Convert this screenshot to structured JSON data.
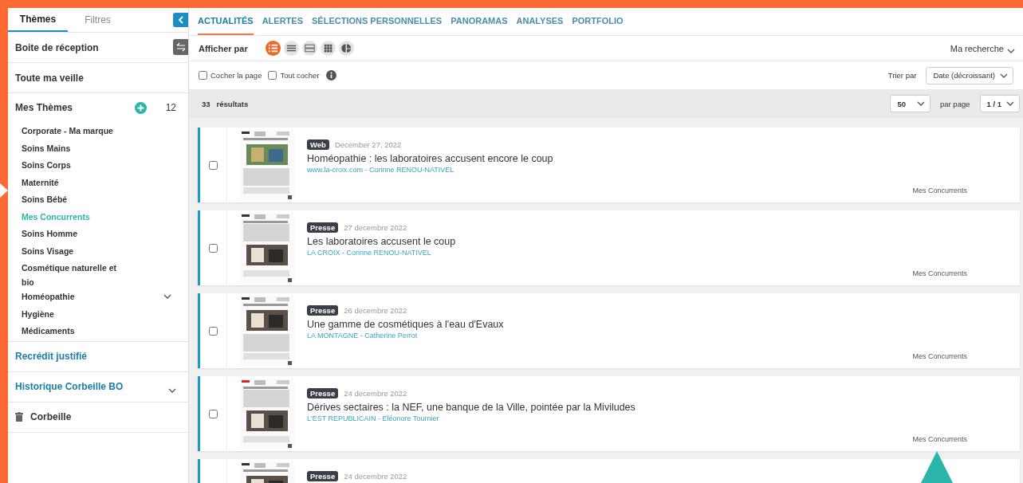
{
  "sidebar": {
    "tabs": [
      {
        "label": "Thèmes",
        "selected": true
      },
      {
        "label": "Filtres",
        "selected": false
      }
    ],
    "sections": [
      {
        "kind": "plain",
        "label": "Boite de réception"
      },
      {
        "kind": "plain",
        "label": "Toute ma veille"
      },
      {
        "kind": "themes",
        "label": "Mes Thèmes",
        "count": "12",
        "items": [
          {
            "label": "Corporate - Ma marque",
            "selected": false,
            "expandable": false
          },
          {
            "label": "Soins Mains",
            "selected": false,
            "expandable": false
          },
          {
            "label": "Soins Corps",
            "selected": false,
            "expandable": false
          },
          {
            "label": "Maternité",
            "selected": false,
            "expandable": false
          },
          {
            "label": "Soins Bébé",
            "selected": false,
            "expandable": false
          },
          {
            "label": "Mes Concurrents",
            "selected": true,
            "expandable": false
          },
          {
            "label": "Soins Homme",
            "selected": false,
            "expandable": false
          },
          {
            "label": "Soins Visage",
            "selected": false,
            "expandable": false
          },
          {
            "label": "Cosmétique naturelle et bio",
            "selected": false,
            "expandable": false
          },
          {
            "label": "Homéopathie",
            "selected": false,
            "expandable": true
          },
          {
            "label": "Hygiène",
            "selected": false,
            "expandable": false
          },
          {
            "label": "Médicaments",
            "selected": false,
            "expandable": false
          }
        ]
      },
      {
        "kind": "link",
        "label": "Recrédit justifié",
        "expandable": false
      },
      {
        "kind": "link",
        "label": "Historique Corbeille BO",
        "expandable": true
      },
      {
        "kind": "trash",
        "label": "Corbeille"
      }
    ]
  },
  "nav": [
    {
      "label": "ACTUALITÉS",
      "selected": true
    },
    {
      "label": "ALERTES",
      "selected": false
    },
    {
      "label": "SÉLECTIONS PERSONNELLES",
      "selected": false
    },
    {
      "label": "PANORAMAS",
      "selected": false
    },
    {
      "label": "ANALYSES",
      "selected": false
    },
    {
      "label": "PORTFOLIO",
      "selected": false
    }
  ],
  "toolbar": {
    "label": "Afficher par",
    "views": [
      {
        "kind": "list",
        "selected": true
      },
      {
        "kind": "lines",
        "selected": false
      },
      {
        "kind": "rows",
        "selected": false
      },
      {
        "kind": "grid",
        "selected": false
      },
      {
        "kind": "chart",
        "selected": false
      }
    ],
    "search_menu": "Ma recherche"
  },
  "selection": {
    "page": {
      "label": "Cocher la page",
      "checked": false
    },
    "all": {
      "label": "Tout cocher",
      "checked": false
    },
    "sort_label": "Trier par",
    "sort_value": "Date (décroissant)"
  },
  "results": {
    "count": "33",
    "label": "résultats",
    "per_page": "50",
    "per_page_label": "par page",
    "page": "1 / 1"
  },
  "articles": [
    {
      "type": "Web",
      "date": "December 27, 2022",
      "title": "Homéopathie : les laboratoires accusent encore le coup",
      "source": "www.la-croix.com - Corinne RENOU-NATIVEL",
      "theme": "Mes Concurrents",
      "checked": false
    },
    {
      "type": "Presse",
      "date": "27 decembre 2022",
      "title": "Les laboratoires accusent le coup",
      "source": "LA CROIX - Corinne RENOU-NATIVEL",
      "theme": "Mes Concurrents",
      "checked": false
    },
    {
      "type": "Presse",
      "date": "26 decembre 2022",
      "title": "Une gamme de cosmétiques à l'eau d'Evaux",
      "source": "LA MONTAGNE - Catherine Perrot",
      "theme": "Mes Concurrents",
      "checked": false
    },
    {
      "type": "Presse",
      "date": "24 decembre 2022",
      "title": "Dérives sectaires : la NEF, une banque de la Ville, pointée par la Miviludes",
      "source": "L'EST REPUBLICAIN - Eléonore Tournier",
      "theme": "Mes Concurrents",
      "checked": false
    },
    {
      "type": "Presse",
      "date": "24 decembre 2022"
    }
  ]
}
